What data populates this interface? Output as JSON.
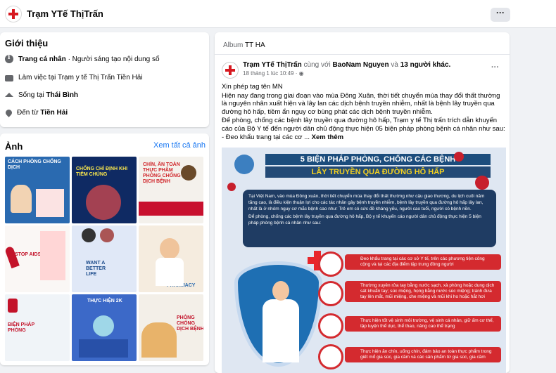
{
  "page": {
    "name": "Trạm YTế ThịTrấn",
    "more_label": "···"
  },
  "intro": {
    "title": "Giới thiệu",
    "rows": [
      {
        "icon": "info-icon",
        "bold": "Trang cá nhân",
        "text": " · Người sáng tạo nội dung số"
      },
      {
        "icon": "briefcase-icon",
        "bold": "",
        "text": "Làm việc tại Trạm y tế Thị Trấn Tiền Hải"
      },
      {
        "icon": "home-icon",
        "bold": "Thái Bình",
        "prefix": "Sống tại "
      },
      {
        "icon": "location-icon",
        "bold": "Tiền Hải",
        "prefix": "Đến từ "
      }
    ]
  },
  "photos": {
    "title": "Ảnh",
    "see_all": "Xem tất cả ảnh",
    "tiles": [
      {
        "caption": "Cách phòng chống dịch",
        "bg": "#2a6ab0"
      },
      {
        "caption": "Chống chỉ định khi tiêm chủng",
        "bg": "#0f2a63"
      },
      {
        "caption": "Chín, ăn toàn thực phẩm phòng chống dịch bệnh",
        "bg": "#f4f1ec"
      },
      {
        "caption": "Stop AIDS",
        "bg": "#faf7f5"
      },
      {
        "caption": "Want a better life",
        "bg": "#e0e8f7"
      },
      {
        "caption": "Pharmacy",
        "bg": "#f5ecdf"
      },
      {
        "caption": "Biện pháp phòng",
        "bg": "#f0f4f8"
      },
      {
        "caption": "Thực hiện 2K",
        "bg": "#3c69c8"
      },
      {
        "caption": "Phòng chống dịch bệnh",
        "bg": "#f3efe8"
      }
    ]
  },
  "post": {
    "album_prefix": "Album ",
    "album": "TT HA",
    "author": "Trạm YTế ThịTrấn",
    "with_text": " cùng với ",
    "tagged": "BaoNam Nguyen",
    "and_text": " và ",
    "others": "13 người khác.",
    "timestamp": "18 tháng 1 lúc 10:49 · ",
    "more_label": "···",
    "lines": [
      "Xin phép tag tên MN",
      "Hiện nay đang trong giai đoạn vào mùa Đông Xuân, thời tiết chuyển mùa thay đổi thất thường là nguyên nhân xuất hiện và lây lan các dịch bệnh truyền nhiễm, nhất là bệnh lây truyền qua đường hô hấp, tiềm ẩn nguy cơ bùng phát các dịch bệnh truyền nhiễm.",
      "Để phòng, chống các bệnh lây truyền qua đường hô hấp, Trạm y tế Thị trấn trích dẫn khuyến cáo của Bộ Y tế đến người dân chủ động thực hiện 05 biện pháp phòng bệnh cá nhân như sau:"
    ],
    "last_line": "- Đeo khẩu trang tại các cơ ...",
    "see_more": " Xem thêm",
    "poster": {
      "title_1": "5 BIỆN PHÁP PHÒNG, CHỐNG CÁC BỆNH",
      "title_2": "LÂY TRUYỀN QUA ĐƯỜNG HÔ HẤP",
      "intro_1": "Tại Việt Nam, vào mùa Đông xuân, thời tiết chuyển mùa thay đổi thất thường như cậu giao thương, du lịch cuối năm tăng cao, là điều kiện thuận lợi cho các tác nhân gây bệnh truyền nhiễm, bệnh lây truyền qua đường hô hấp lây lan, nhất là ở nhóm nguy cơ mắc bệnh cao như: Trẻ em có sức đề kháng yếu, người cao tuổi, người có bệnh nền.",
      "intro_2": "Để phòng, chống các bệnh lây truyền qua đường hô hấp, Bộ y tế khuyến cáo người dân chủ động thực hiện 5 biện pháp phòng bệnh cá nhân như sau:",
      "measures": [
        "Đeo khẩu trang tại các cơ sở Y tế, trên các phương tiện công cộng và tại các địa điểm tập trung đông người",
        "Thường xuyên rửa tay bằng nước sạch, xà phòng hoặc dung dịch sát khuẩn tay; súc miệng, họng bằng nước súc miệng; tránh đưa tay lên mắt, mũi miệng, che miệng và mũi khi ho hoặc hắt hơi",
        "Thực hiện tốt vệ sinh môi trường, vệ sinh cá nhân, giữ ấm cơ thể, tập luyện thể dục, thể thao, nâng cao thể trạng",
        "Thực hiện ăn chín, uống chín, đảm bảo an toàn thực phẩm trong giết mổ gia súc, gia cầm và các sản phẩm từ gia súc, gia cầm"
      ]
    }
  },
  "colors": {
    "link": "#1877f2",
    "poster_red": "#d42a2f",
    "poster_navy": "#1c4d7d"
  }
}
